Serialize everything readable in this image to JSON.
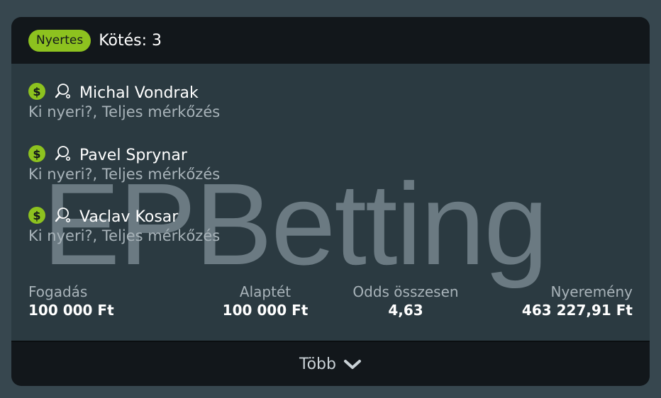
{
  "header": {
    "status_badge": "Nyertes",
    "title": "Kötés: 3"
  },
  "watermark": "EPBetting",
  "selections": [
    {
      "player": "Michal Vondrak",
      "market": "Ki nyeri?, Teljes mérkőzés",
      "icons": [
        "dollar-icon",
        "table-tennis-icon"
      ]
    },
    {
      "player": "Pavel Sprynar",
      "market": "Ki nyeri?, Teljes mérkőzés",
      "icons": [
        "dollar-icon",
        "table-tennis-icon"
      ]
    },
    {
      "player": "Vaclav Kosar",
      "market": "Ki nyeri?, Teljes mérkőzés",
      "icons": [
        "dollar-icon",
        "table-tennis-icon"
      ]
    }
  ],
  "stats": {
    "stake": {
      "label": "Fogadás",
      "value": "100 000 Ft"
    },
    "base_stake": {
      "label": "Alaptét",
      "value": "100 000 Ft"
    },
    "total_odds": {
      "label": "Odds összesen",
      "value": "4,63"
    },
    "winnings": {
      "label": "Nyeremény",
      "value": "463 227,91 Ft"
    }
  },
  "footer": {
    "more_label": "Több"
  },
  "colors": {
    "background": "#37474f",
    "card": "#2b3a41",
    "header": "#12171b",
    "accent_green": "#8dc21f",
    "muted_text": "#a8b3b9"
  }
}
